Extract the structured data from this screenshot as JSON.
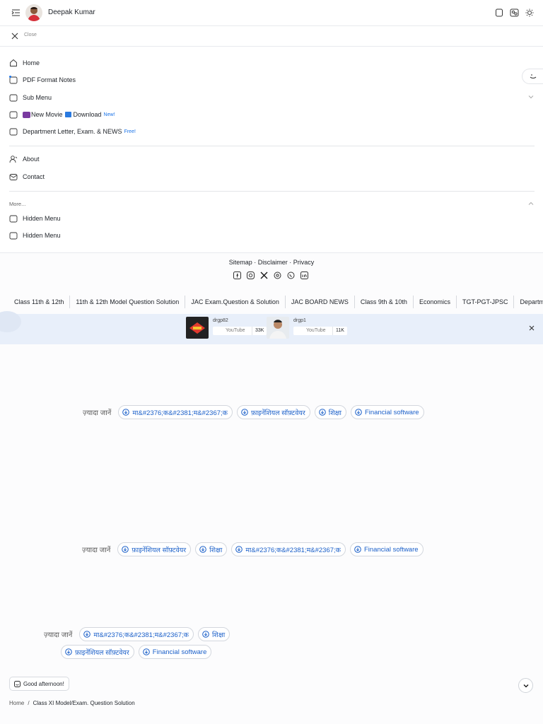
{
  "header": {
    "user_name": "Deepak Kumar"
  },
  "closebar": {
    "close_label": "Close"
  },
  "menu": {
    "items": [
      {
        "label": "Home"
      },
      {
        "label": "PDF Format Notes"
      },
      {
        "label": "Sub Menu"
      },
      {
        "label": "New Movie",
        "extra": "Download",
        "badge": "New!"
      },
      {
        "label": "Department Letter, Exam. & NEWS",
        "badge": "Free!"
      }
    ],
    "items2": [
      {
        "label": "About"
      },
      {
        "label": "Contact"
      }
    ],
    "more_label": "More...",
    "hidden_items": [
      {
        "label": "Hidden Menu"
      },
      {
        "label": "Hidden Menu"
      }
    ]
  },
  "footer": {
    "sitemap": "Sitemap",
    "disclaimer": "Disclaimer",
    "privacy": "Privacy",
    "dot": "·"
  },
  "labels": [
    "Class 11th & 12th",
    "11th & 12th Model Question Solution",
    "JAC Exam.Question & Solution",
    "JAC BOARD NEWS",
    "Class 9th & 10th",
    "Economics",
    "TGT-PGT-JPSC",
    "Department"
  ],
  "youtube": [
    {
      "name": "drgp82",
      "platform": "YouTube",
      "subs": "33K"
    },
    {
      "name": "drgp1",
      "platform": "YouTube",
      "subs": "11K"
    }
  ],
  "related": {
    "lead": "ज़्यादा जानें",
    "row1": [
      "मा&#2376;क&#2381;म&#2367;क",
      "फ़ाइनेंशियल सॉफ़्टवेयर",
      "शिक्षा",
      "Financial software"
    ],
    "row2": [
      "फ़ाइनेंशियल सॉफ़्टवेयर",
      "शिक्षा",
      "मा&#2376;क&#2381;म&#2367;क",
      "Financial software"
    ],
    "row3a": [
      "मा&#2376;क&#2381;म&#2367;क",
      "शिक्षा"
    ],
    "row3b": [
      "फ़ाइनेंशियल सॉफ़्टवेयर",
      "Financial software"
    ]
  },
  "greeting": "Good afternoon!",
  "breadcrumb": {
    "home": "Home",
    "sep": "/",
    "current": "Class XI Model/Exam. Question Solution"
  },
  "colors": {
    "accent": "#1a73e8",
    "chip_text": "#1a5fc9",
    "youtube_bar": "#e8effa"
  }
}
